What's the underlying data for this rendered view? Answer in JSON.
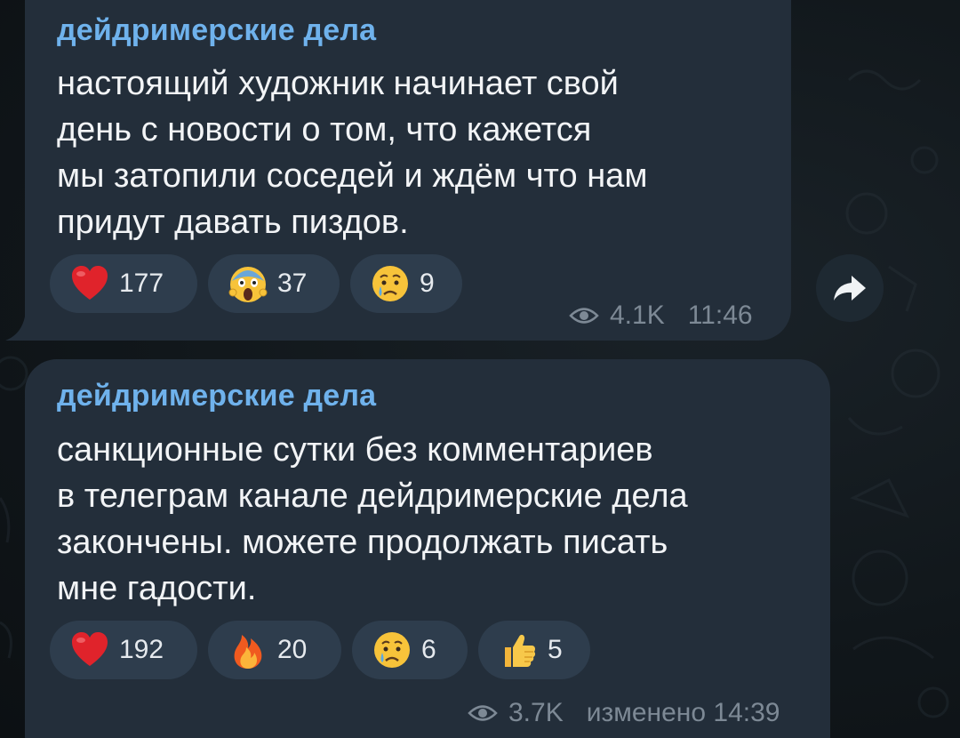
{
  "messages": [
    {
      "channel": "дейдримерские дела",
      "lines": [
        "настоящий художник начинает свой",
        "день с новости о том, что кажется",
        "мы затопили соседей и ждём что нам",
        "придут давать пиздов."
      ],
      "reactions": [
        {
          "emoji": "heart-icon",
          "count": "177"
        },
        {
          "emoji": "scream-face-icon",
          "count": "37"
        },
        {
          "emoji": "crying-face-icon",
          "count": "9"
        }
      ],
      "views": "4.1K",
      "time": "11:46"
    },
    {
      "channel": "дейдримерские дела",
      "lines": [
        "санкционные сутки без комментариев",
        "в телеграм канале дейдримерские дела",
        "закончены. можете продолжать писать",
        "мне гадости."
      ],
      "reactions": [
        {
          "emoji": "heart-icon",
          "count": "192"
        },
        {
          "emoji": "fire-icon",
          "count": "20"
        },
        {
          "emoji": "crying-face-icon",
          "count": "6"
        },
        {
          "emoji": "thumbs-up-icon",
          "count": "5"
        }
      ],
      "views": "3.7K",
      "time": "изменено 14:39"
    }
  ],
  "share": {
    "icon": "share-arrow-icon"
  },
  "colors": {
    "bubble": "#232e3a",
    "channel_name": "#6fb2ec",
    "text": "#f2f4f6",
    "reaction_pill": "#2e3d4d",
    "meta": "#7d8995",
    "background": "#11171b"
  }
}
